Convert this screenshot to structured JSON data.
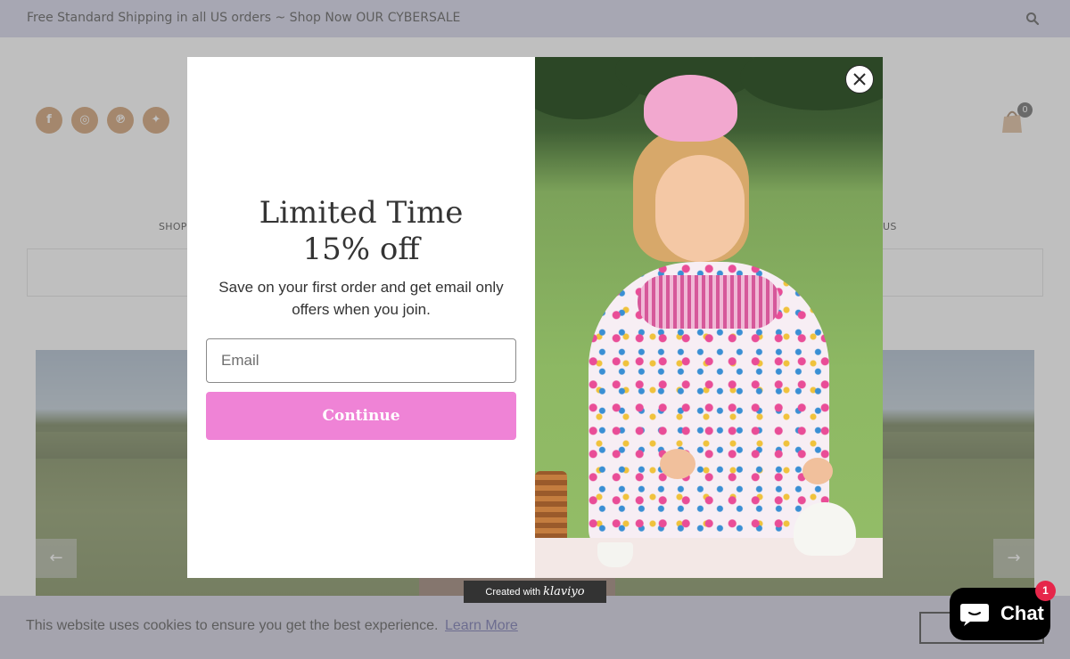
{
  "announcement": {
    "text": "Free Standard Shipping in all US orders ~ Shop Now OUR CYBERSALE",
    "search_icon": "search-icon"
  },
  "header": {
    "social_links": [
      {
        "name": "facebook",
        "glyph": "f"
      },
      {
        "name": "instagram",
        "glyph": "◎"
      },
      {
        "name": "pinterest",
        "glyph": "℗"
      },
      {
        "name": "twitter",
        "glyph": "✦"
      }
    ],
    "cart_count": "0",
    "nav_left_label": "SHOP",
    "nav_right_label": "US"
  },
  "hero": {
    "prev_arrow": "←",
    "next_arrow": "→"
  },
  "popup": {
    "title_line1": "Limited Time",
    "title_line2": "15% off",
    "subtitle": "Save on your first order and get email only offers when you join.",
    "email_placeholder": "Email",
    "email_value": "",
    "continue_label": "Continue"
  },
  "klaviyo_badge": {
    "prefix": "Created with",
    "brand": "klaviyo"
  },
  "cookie_bar": {
    "text": "This website uses cookies to ensure you get the best experience.",
    "link_label": "Learn More"
  },
  "chat_widget": {
    "label": "Chat",
    "badge_count": "1"
  },
  "colors": {
    "announcement_bg": "#cfcfe6",
    "social_brown": "#c88f5a",
    "continue_pink": "#ef83d6",
    "cookie_bg": "#cbc9dc",
    "chat_badge_red": "#e6264a"
  }
}
